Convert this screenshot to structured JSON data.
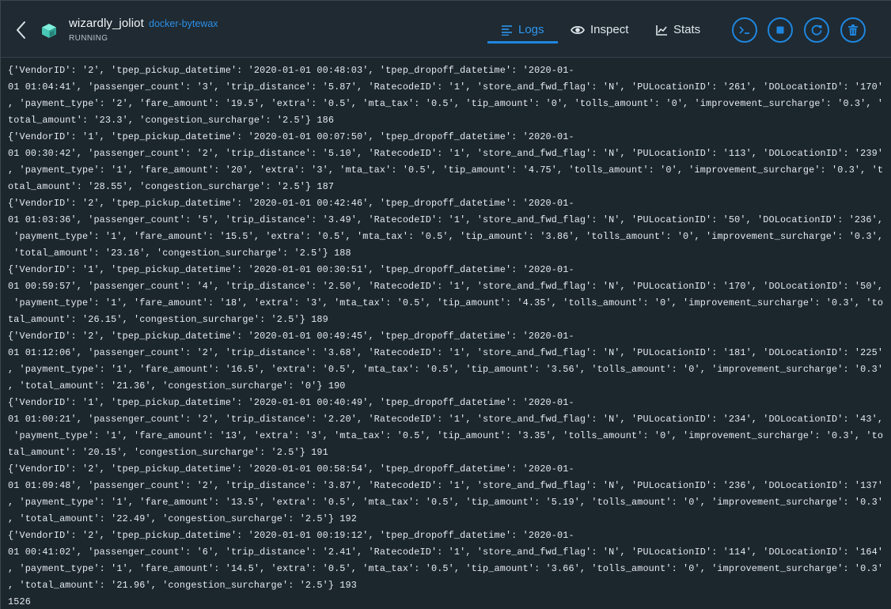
{
  "header": {
    "container_name": "wizardly_joliot",
    "image_name": "docker-bytewax",
    "status": "RUNNING",
    "back_icon": "chevron-left-icon",
    "container_icon": "container-cube-icon"
  },
  "tabs": [
    {
      "label": "Logs",
      "icon": "list-lines-icon",
      "active": true
    },
    {
      "label": "Inspect",
      "icon": "eye-icon",
      "active": false
    },
    {
      "label": "Stats",
      "icon": "line-chart-icon",
      "active": false
    }
  ],
  "actions": [
    {
      "name": "cli",
      "icon": "terminal-prompt-icon"
    },
    {
      "name": "stop",
      "icon": "stop-square-icon"
    },
    {
      "name": "restart",
      "icon": "restart-arrow-icon"
    },
    {
      "name": "delete",
      "icon": "trash-icon"
    }
  ],
  "colors": {
    "background": "#1c262d",
    "header_background": "#1f2a32",
    "accent": "#1f86de",
    "link": "#2c8fe6",
    "text": "#e4ebf0"
  },
  "logs": [
    "{'VendorID': '2', 'tpep_pickup_datetime': '2020-01-01 00:48:03', 'tpep_dropoff_datetime': '2020-01-",
    "01 01:04:41', 'passenger_count': '3', 'trip_distance': '5.87', 'RatecodeID': '1', 'store_and_fwd_flag': 'N', 'PULocationID': '261', 'DOLocationID': '170'",
    ", 'payment_type': '2', 'fare_amount': '19.5', 'extra': '0.5', 'mta_tax': '0.5', 'tip_amount': '0', 'tolls_amount': '0', 'improvement_surcharge': '0.3', '",
    "total_amount': '23.3', 'congestion_surcharge': '2.5'} 186",
    "{'VendorID': '1', 'tpep_pickup_datetime': '2020-01-01 00:07:50', 'tpep_dropoff_datetime': '2020-01-",
    "01 00:30:42', 'passenger_count': '2', 'trip_distance': '5.10', 'RatecodeID': '1', 'store_and_fwd_flag': 'N', 'PULocationID': '113', 'DOLocationID': '239'",
    ", 'payment_type': '1', 'fare_amount': '20', 'extra': '3', 'mta_tax': '0.5', 'tip_amount': '4.75', 'tolls_amount': '0', 'improvement_surcharge': '0.3', 't",
    "otal_amount': '28.55', 'congestion_surcharge': '2.5'} 187",
    "{'VendorID': '2', 'tpep_pickup_datetime': '2020-01-01 00:42:46', 'tpep_dropoff_datetime': '2020-01-",
    "01 01:03:36', 'passenger_count': '5', 'trip_distance': '3.49', 'RatecodeID': '1', 'store_and_fwd_flag': 'N', 'PULocationID': '50', 'DOLocationID': '236',",
    " 'payment_type': '1', 'fare_amount': '15.5', 'extra': '0.5', 'mta_tax': '0.5', 'tip_amount': '3.86', 'tolls_amount': '0', 'improvement_surcharge': '0.3',",
    " 'total_amount': '23.16', 'congestion_surcharge': '2.5'} 188",
    "{'VendorID': '1', 'tpep_pickup_datetime': '2020-01-01 00:30:51', 'tpep_dropoff_datetime': '2020-01-",
    "01 00:59:57', 'passenger_count': '4', 'trip_distance': '2.50', 'RatecodeID': '1', 'store_and_fwd_flag': 'N', 'PULocationID': '170', 'DOLocationID': '50',",
    " 'payment_type': '1', 'fare_amount': '18', 'extra': '3', 'mta_tax': '0.5', 'tip_amount': '4.35', 'tolls_amount': '0', 'improvement_surcharge': '0.3', 'to",
    "tal_amount': '26.15', 'congestion_surcharge': '2.5'} 189",
    "{'VendorID': '2', 'tpep_pickup_datetime': '2020-01-01 00:49:45', 'tpep_dropoff_datetime': '2020-01-",
    "01 01:12:06', 'passenger_count': '2', 'trip_distance': '3.68', 'RatecodeID': '1', 'store_and_fwd_flag': 'N', 'PULocationID': '181', 'DOLocationID': '225'",
    ", 'payment_type': '1', 'fare_amount': '16.5', 'extra': '0.5', 'mta_tax': '0.5', 'tip_amount': '3.56', 'tolls_amount': '0', 'improvement_surcharge': '0.3'",
    ", 'total_amount': '21.36', 'congestion_surcharge': '0'} 190",
    "{'VendorID': '1', 'tpep_pickup_datetime': '2020-01-01 00:40:49', 'tpep_dropoff_datetime': '2020-01-",
    "01 01:00:21', 'passenger_count': '2', 'trip_distance': '2.20', 'RatecodeID': '1', 'store_and_fwd_flag': 'N', 'PULocationID': '234', 'DOLocationID': '43',",
    " 'payment_type': '1', 'fare_amount': '13', 'extra': '3', 'mta_tax': '0.5', 'tip_amount': '3.35', 'tolls_amount': '0', 'improvement_surcharge': '0.3', 'to",
    "tal_amount': '20.15', 'congestion_surcharge': '2.5'} 191",
    "{'VendorID': '2', 'tpep_pickup_datetime': '2020-01-01 00:58:54', 'tpep_dropoff_datetime': '2020-01-",
    "01 01:09:48', 'passenger_count': '2', 'trip_distance': '3.87', 'RatecodeID': '1', 'store_and_fwd_flag': 'N', 'PULocationID': '236', 'DOLocationID': '137'",
    ", 'payment_type': '1', 'fare_amount': '13.5', 'extra': '0.5', 'mta_tax': '0.5', 'tip_amount': '5.19', 'tolls_amount': '0', 'improvement_surcharge': '0.3'",
    ", 'total_amount': '22.49', 'congestion_surcharge': '2.5'} 192",
    "{'VendorID': '2', 'tpep_pickup_datetime': '2020-01-01 00:19:12', 'tpep_dropoff_datetime': '2020-01-",
    "01 00:41:02', 'passenger_count': '6', 'trip_distance': '2.41', 'RatecodeID': '1', 'store_and_fwd_flag': 'N', 'PULocationID': '114', 'DOLocationID': '164'",
    ", 'payment_type': '1', 'fare_amount': '14.5', 'extra': '0.5', 'mta_tax': '0.5', 'tip_amount': '3.66', 'tolls_amount': '0', 'improvement_surcharge': '0.3'",
    ", 'total_amount': '21.96', 'congestion_surcharge': '2.5'} 193",
    "1526"
  ]
}
